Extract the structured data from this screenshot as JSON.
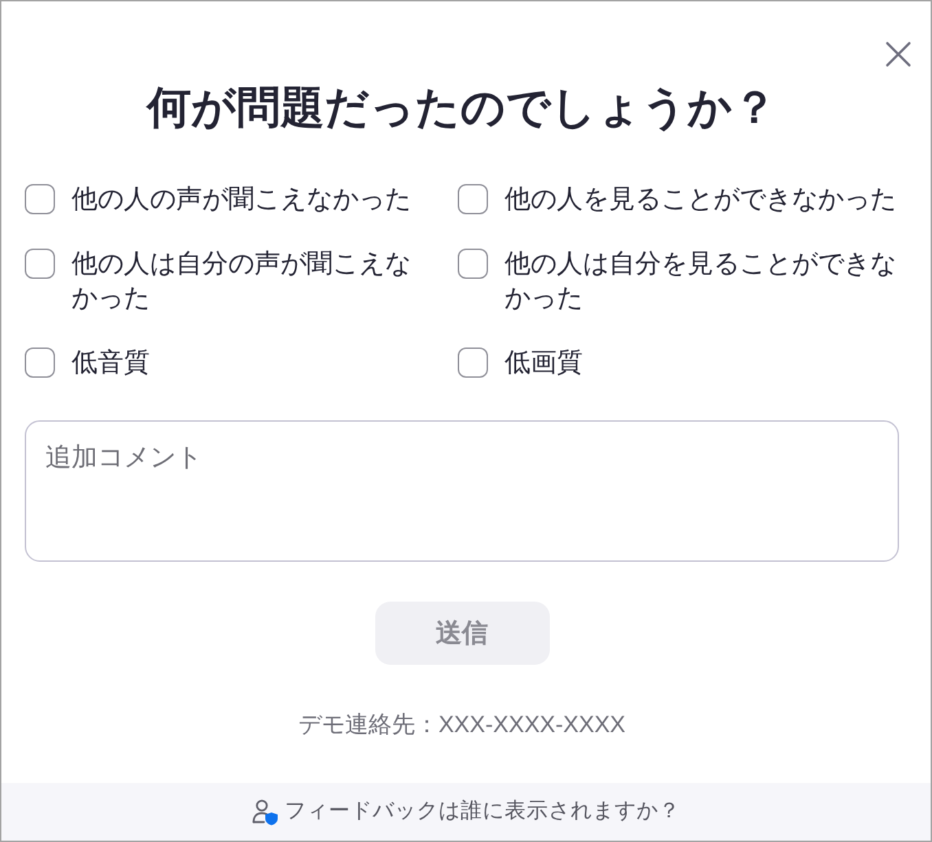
{
  "title": "何が問題だったのでしょうか？",
  "options": [
    {
      "label": "他の人の声が聞こえなかった",
      "checked": false
    },
    {
      "label": "他の人を見ることができなかった",
      "checked": false
    },
    {
      "label": "他の人は自分の声が聞こえなかった",
      "checked": false
    },
    {
      "label": "他の人は自分を見ることができなかった",
      "checked": false
    },
    {
      "label": "低音質",
      "checked": false
    },
    {
      "label": "低画質",
      "checked": false
    }
  ],
  "comment": {
    "placeholder": "追加コメント"
  },
  "submit_button": {
    "label": "送信",
    "disabled": true
  },
  "contact": "デモ連絡先：XXX-XXXX-XXXX",
  "footer": {
    "link": "フィードバックは誰に表示されますか？"
  }
}
